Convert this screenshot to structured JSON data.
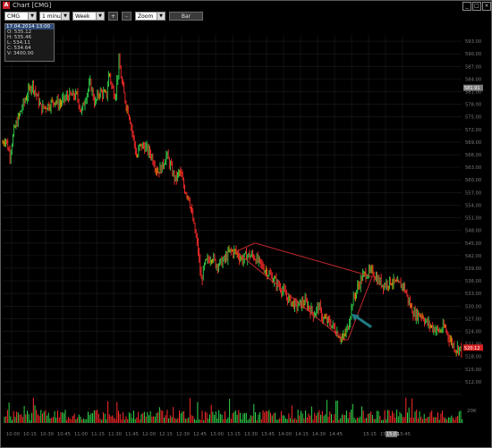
{
  "window": {
    "title": "Chart [CMG]",
    "app_icon": "A"
  },
  "toolbar": {
    "symbol": "CMG",
    "interval": "1 minute",
    "period": "Week",
    "zoom_in_label": "+",
    "zoom_out_label": "-",
    "zoom": "Zoom",
    "chart_type": "Bar"
  },
  "ohlc_box": {
    "header": "17.04.2014 13:00",
    "open": "O: 535.12",
    "high": "H: 535.46",
    "low": "L: 534.11",
    "close": "C: 534.64",
    "volume": "V: 3400.00"
  },
  "colors": {
    "up": "#2fd34a",
    "down": "#ff2a2a",
    "mixed": "#e0a000",
    "axis_text": "#7a7a7a",
    "grid": "#1d1d1d",
    "channel": "#c8282e",
    "arrow": "#1f7b83",
    "price_tag": "#d72222",
    "crosshair_tag": "#7a7a7a"
  },
  "chart_data": {
    "type": "bar",
    "symbol": "CMG",
    "y_ticks": [
      "593.00",
      "590.00",
      "587.00",
      "584.00",
      "581.00",
      "578.00",
      "575.00",
      "572.00",
      "569.00",
      "566.00",
      "563.00",
      "560.00",
      "557.00",
      "554.00",
      "551.00",
      "548.00",
      "545.00",
      "542.00",
      "539.00",
      "536.00",
      "533.00",
      "530.00",
      "527.00",
      "524.00",
      "521.00",
      "518.00",
      "515.00",
      "512.00"
    ],
    "ylim": [
      510.5,
      594.5
    ],
    "x_ticks": [
      "10:00",
      "10:15",
      "10:30",
      "10:45",
      "11:00",
      "11:15",
      "11:30",
      "11:45",
      "12:00",
      "12:15",
      "12:30",
      "12:45",
      "13:00",
      "13:15",
      "13:30",
      "13:45",
      "14:00",
      "14:15",
      "14:30",
      "14:45",
      "",
      "15:15",
      "15:30",
      "15:45"
    ],
    "crosshair_price": "581.91",
    "crosshair_time": "15:01",
    "last_price": "520.12",
    "volume_label": "20K",
    "price_path": [
      [
        0,
        568
      ],
      [
        5,
        570
      ],
      [
        10,
        566
      ],
      [
        15,
        572
      ],
      [
        25,
        578
      ],
      [
        35,
        583
      ],
      [
        40,
        580
      ],
      [
        45,
        577
      ],
      [
        55,
        578
      ],
      [
        60,
        579
      ],
      [
        65,
        578
      ],
      [
        75,
        580
      ],
      [
        85,
        580
      ],
      [
        90,
        576
      ],
      [
        95,
        580
      ],
      [
        100,
        583
      ],
      [
        105,
        578
      ],
      [
        110,
        581
      ],
      [
        118,
        580
      ],
      [
        121,
        586
      ],
      [
        124,
        582
      ],
      [
        128,
        580
      ],
      [
        132,
        588
      ],
      [
        136,
        582
      ],
      [
        140,
        578
      ],
      [
        144,
        575
      ],
      [
        148,
        570
      ],
      [
        152,
        565
      ],
      [
        155,
        568
      ],
      [
        160,
        568
      ],
      [
        168,
        566
      ],
      [
        175,
        562
      ],
      [
        180,
        563
      ],
      [
        185,
        566
      ],
      [
        190,
        563
      ],
      [
        195,
        560
      ],
      [
        200,
        562
      ],
      [
        205,
        558
      ],
      [
        210,
        556
      ],
      [
        215,
        550
      ],
      [
        220,
        544
      ],
      [
        224,
        536
      ],
      [
        228,
        540
      ],
      [
        232,
        541
      ],
      [
        236,
        542
      ],
      [
        240,
        540
      ],
      [
        244,
        540
      ],
      [
        250,
        541
      ],
      [
        256,
        543
      ],
      [
        262,
        543
      ],
      [
        266,
        542
      ],
      [
        270,
        541
      ],
      [
        274,
        542
      ],
      [
        282,
        542
      ],
      [
        290,
        540
      ],
      [
        298,
        538
      ],
      [
        306,
        536
      ],
      [
        314,
        534
      ],
      [
        320,
        532
      ],
      [
        330,
        530
      ],
      [
        340,
        531
      ],
      [
        350,
        528
      ],
      [
        355,
        530
      ],
      [
        360,
        527
      ],
      [
        368,
        526
      ],
      [
        375,
        524
      ],
      [
        382,
        522
      ],
      [
        388,
        525
      ],
      [
        393,
        531
      ],
      [
        398,
        534
      ],
      [
        404,
        537
      ],
      [
        410,
        538
      ],
      [
        416,
        538
      ],
      [
        422,
        536
      ],
      [
        428,
        535
      ],
      [
        436,
        536
      ],
      [
        444,
        535
      ],
      [
        450,
        535
      ],
      [
        456,
        531
      ],
      [
        462,
        528
      ],
      [
        470,
        528
      ],
      [
        476,
        526
      ],
      [
        482,
        525
      ],
      [
        490,
        524
      ],
      [
        496,
        525
      ],
      [
        502,
        522
      ],
      [
        508,
        520
      ],
      [
        513,
        520
      ],
      [
        516,
        519
      ]
    ],
    "channel": {
      "upper": [
        [
          284,
          545
        ],
        [
          415,
          537
        ]
      ],
      "lower": [
        [
          263,
          543
        ],
        [
          383,
          522
        ],
        [
          388,
          522
        ]
      ],
      "right_side": [
        [
          388,
          522
        ],
        [
          415,
          537
        ]
      ],
      "left_side": [
        [
          263,
          543
        ],
        [
          284,
          545
        ]
      ]
    },
    "arrow_at": [
      [
        392,
        528
      ]
    ],
    "grid": true
  }
}
